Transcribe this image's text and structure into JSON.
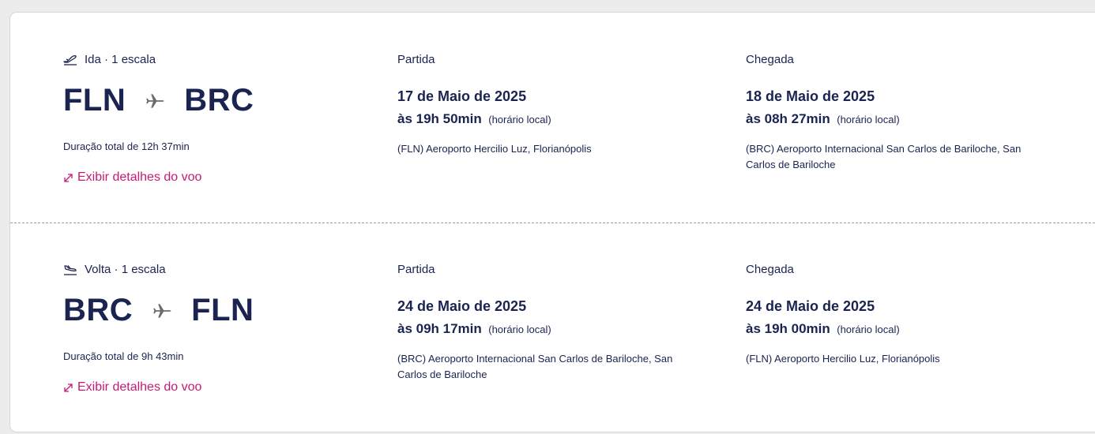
{
  "outbound": {
    "direction": "Ida · 1 escala",
    "origin": "FLN",
    "destination": "BRC",
    "duration": "Duração total de 12h 37min",
    "details_link": "Exibir detalhes do voo",
    "departure": {
      "label": "Partida",
      "date": "17 de Maio de 2025",
      "time": "às 19h 50min",
      "tz": "(horário local)",
      "airport": "(FLN) Aeroporto Hercilio Luz, Florianópolis"
    },
    "arrival": {
      "label": "Chegada",
      "date": "18 de Maio de 2025",
      "time": "às 08h 27min",
      "tz": "(horário local)",
      "airport": "(BRC) Aeroporto Internacional San Carlos de Bariloche, San Carlos de Bariloche"
    }
  },
  "return": {
    "direction": "Volta · 1 escala",
    "origin": "BRC",
    "destination": "FLN",
    "duration": "Duração total de 9h 43min",
    "details_link": "Exibir detalhes do voo",
    "departure": {
      "label": "Partida",
      "date": "24 de Maio de 2025",
      "time": "às 09h 17min",
      "tz": "(horário local)",
      "airport": "(BRC) Aeroporto Internacional San Carlos de Bariloche, San Carlos de Bariloche"
    },
    "arrival": {
      "label": "Chegada",
      "date": "24 de Maio de 2025",
      "time": "às 19h 00min",
      "tz": "(horário local)",
      "airport": "(FLN) Aeroporto Hercilio Luz, Florianópolis"
    }
  },
  "icons": {
    "takeoff": "plane-takeoff-icon",
    "landing": "plane-landing-icon",
    "route": "airplane-icon",
    "expand": "expand-arrows-icon"
  },
  "colors": {
    "text": "#1b2350",
    "link": "#c71a75",
    "route_plane": "#6b6b6b"
  }
}
